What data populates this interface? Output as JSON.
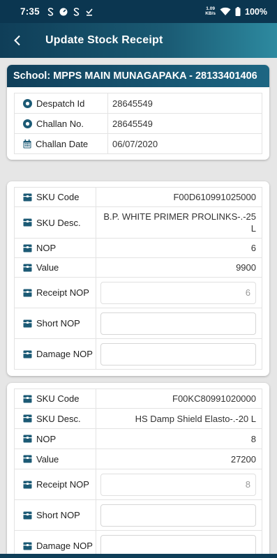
{
  "status": {
    "time": "7:35",
    "net_speed_value": "1.09",
    "net_speed_unit": "KB/s",
    "battery": "100%"
  },
  "appbar": {
    "title": "Update Stock Receipt"
  },
  "school": {
    "header": "School: MPPS MAIN MUNAGAPAKA - 28133401406",
    "rows": [
      {
        "label": "Despatch Id",
        "value": "28645549",
        "icon": "radio-icon"
      },
      {
        "label": "Challan No.",
        "value": "28645549",
        "icon": "radio-icon"
      },
      {
        "label": "Challan Date",
        "value": "06/07/2020",
        "icon": "calendar-icon"
      }
    ]
  },
  "labels": {
    "sku_code": "SKU Code",
    "sku_desc": "SKU Desc.",
    "nop": "NOP",
    "value": "Value",
    "receipt_nop": "Receipt NOP",
    "short_nop": "Short NOP",
    "damage_nop": "Damage NOP"
  },
  "items": [
    {
      "sku_code": "F00D610991025000",
      "sku_desc": "B.P. WHITE PRIMER PROLINKS-.-25 L",
      "nop": "6",
      "value": "9900",
      "receipt_nop": "6",
      "short_nop": "",
      "damage_nop": ""
    },
    {
      "sku_code": "F00KC80991020000",
      "sku_desc": "HS Damp Shield Elasto-.-20 L",
      "nop": "8",
      "value": "27200",
      "receipt_nop": "8",
      "short_nop": "",
      "damage_nop": ""
    }
  ],
  "colors": {
    "primary": "#0f3e58",
    "accent": "#1d6683",
    "icon": "#1c5a75"
  }
}
